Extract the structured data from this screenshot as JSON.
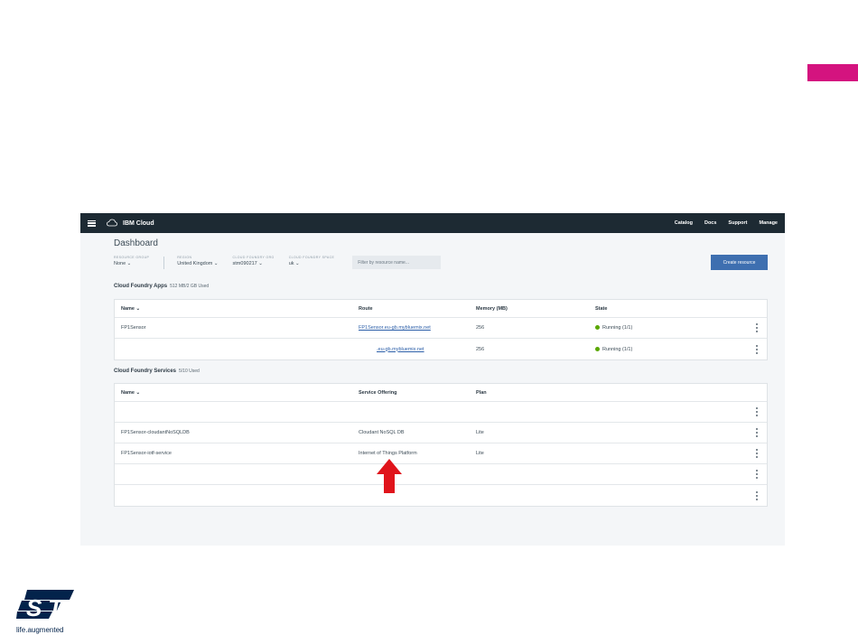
{
  "colors": {
    "accent_pink": "#d4137f",
    "topbar": "#1d2a33",
    "primary_button": "#3e6fb0",
    "arrow": "#e0141b",
    "running_dot": "#5aa700",
    "logo_blue": "#03234b"
  },
  "topbar": {
    "brand": "IBM Cloud",
    "nav": [
      "Catalog",
      "Docs",
      "Support",
      "Manage"
    ]
  },
  "dashboard": {
    "title": "Dashboard",
    "filters": [
      {
        "label": "RESOURCE GROUP",
        "value": "None ⌄"
      },
      {
        "label": "REGION",
        "value": "United Kingdom ⌄"
      },
      {
        "label": "CLOUD FOUNDRY ORG",
        "value": "stm090217 ⌄"
      },
      {
        "label": "CLOUD FOUNDRY SPACE",
        "value": "uk ⌄"
      }
    ],
    "filter_placeholder": "Filter by resource name...",
    "create_button": "Create resource"
  },
  "apps": {
    "title": "Cloud Foundry Apps",
    "usage": "512 MB/2 GB Used",
    "columns": [
      "Name ⌄",
      "Route",
      "Memory (MB)",
      "State"
    ],
    "rows": [
      {
        "name": "FP1Sensor",
        "route": "FP1Sensor.eu-gb.mybluemix.net",
        "memory": "256",
        "state": "Running (1/1)"
      },
      {
        "name": "",
        "route": ".eu-gb.mybluemix.net",
        "memory": "256",
        "state": "Running (1/1)"
      }
    ]
  },
  "services": {
    "title": "Cloud Foundry Services",
    "usage": "5/10 Used",
    "columns": [
      "Name ⌄",
      "Service Offering",
      "Plan"
    ],
    "rows": [
      {
        "name": "",
        "offering": "",
        "plan": ""
      },
      {
        "name": "FP1Sensor-cloudantNoSQLDB",
        "offering": "Cloudant NoSQL DB",
        "plan": "Lite"
      },
      {
        "name": "FP1Sensor-iotf-service",
        "offering": "Internet of Things Platform",
        "plan": "Lite"
      },
      {
        "name": "",
        "offering": "",
        "plan": ""
      },
      {
        "name": "",
        "offering": "",
        "plan": ""
      }
    ]
  },
  "footer": {
    "logo_tagline": "life.augmented"
  }
}
